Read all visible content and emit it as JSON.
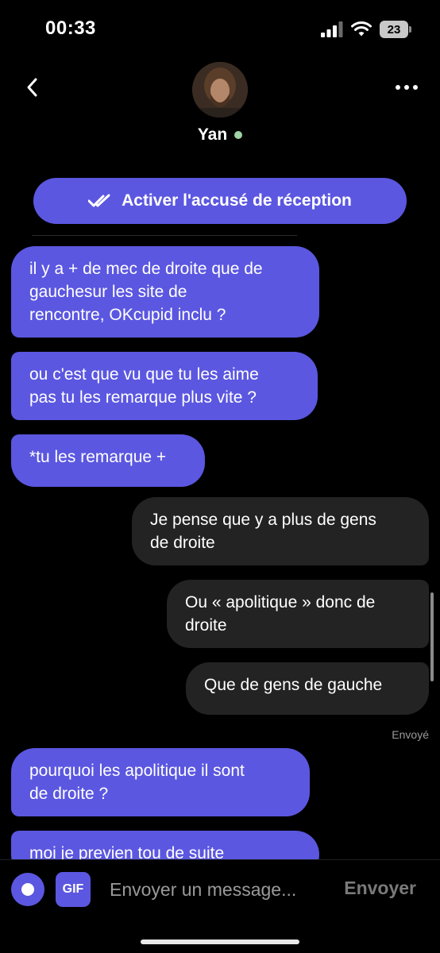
{
  "status_bar": {
    "time": "00:33",
    "battery": "23"
  },
  "header": {
    "contact_name": "Yan",
    "online": true
  },
  "read_receipts_button": {
    "label": "Activer l'accusé de réception"
  },
  "messages": [
    {
      "direction": "received",
      "text": "il y a + de mec de droite que de\ngauchesur les site de\nrencontre, OKcupid inclu ?"
    },
    {
      "direction": "received",
      "text": "ou c'est que vu que tu les aime\npas tu les remarque plus vite ?"
    },
    {
      "direction": "received",
      "text": "*tu les remarque +"
    },
    {
      "direction": "sent",
      "text": "Je pense que y a plus de gens\nde droite"
    },
    {
      "direction": "sent",
      "text": "Ou « apolitique » donc de\ndroite"
    },
    {
      "direction": "sent",
      "text": "Que de gens de gauche"
    },
    {
      "direction": "received",
      "text": "pourquoi les apolitique il sont\nde droite ?"
    },
    {
      "direction": "received",
      "text": "moi je previen tou de suite"
    }
  ],
  "sent_status": "Envoyé",
  "composer": {
    "gif_label": "GIF",
    "placeholder": "Envoyer un message...",
    "send_label": "Envoyer"
  },
  "colors": {
    "accent": "#5b57e0",
    "sent_bubble": "#232323",
    "online": "#9fd3a6"
  }
}
